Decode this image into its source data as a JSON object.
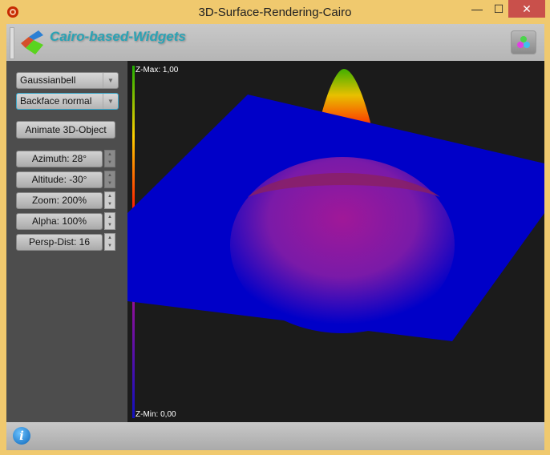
{
  "window": {
    "title": "3D-Surface-Rendering-Cairo",
    "minimize": "—",
    "maximize": "☐",
    "close": "✕"
  },
  "header": {
    "brand": "Cairo-based-Widgets"
  },
  "sidebar": {
    "shape_combo": "Gaussianbell",
    "backface_combo": "Backface normal",
    "animate_label": "Animate 3D-Object",
    "params": [
      {
        "label": "Azimuth: 28°",
        "enabled": false
      },
      {
        "label": "Altitude: -30°",
        "enabled": false
      },
      {
        "label": "Zoom: 200%",
        "enabled": true
      },
      {
        "label": "Alpha: 100%",
        "enabled": true
      },
      {
        "label": "Persp-Dist: 16",
        "enabled": true
      }
    ]
  },
  "canvas": {
    "zmax_label": "Z-Max: 1,00",
    "zmin_label": "Z-Min: 0,00",
    "plane_color": "#0000c8",
    "peak_colors": [
      "#3cb400",
      "#ffd000",
      "#ff2000",
      "#a01890"
    ]
  },
  "status": {
    "info_icon": "i"
  }
}
